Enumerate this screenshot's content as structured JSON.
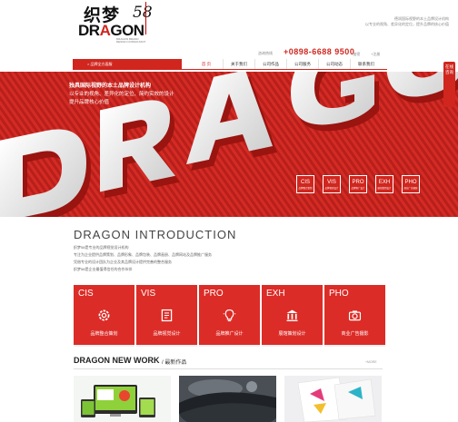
{
  "header": {
    "logo_cn": "织梦",
    "logo_num": "58",
    "logo_en_part1": "DR",
    "logo_en_accent": "A",
    "logo_en_part2": "GON",
    "logo_sub": "DRAGON BRAND DESIGN CONSULTANT",
    "intro_lines": [
      "德润国际视野的本土品牌设计机构",
      "以专业的视角、差异化的定位，提升品牌的核心价值"
    ],
    "phone_label": "咨询热线",
    "phone": "+0898-6688 9500",
    "link_login": "+加密",
    "link_reg": "+注册"
  },
  "nav": {
    "left_label": "> 品牌全方面服",
    "items": [
      "首 页",
      "关于我们",
      "公司作品",
      "公司服务",
      "公司动态",
      "联系我们"
    ],
    "active_index": 0
  },
  "side_tab": "在线咨询",
  "banner": {
    "title": "独具国际视野的本土品牌设计机构",
    "lines": [
      "以专业的视角、差异化的定位、简约实效的设计",
      "提升品牌核心价值"
    ],
    "services": [
      {
        "code": "CIS",
        "label": "品牌整合策划"
      },
      {
        "code": "VIS",
        "label": "品牌视觉设计"
      },
      {
        "code": "PRO",
        "label": "品牌推广设计"
      },
      {
        "code": "EXH",
        "label": "展馆策划设计"
      },
      {
        "code": "PHO",
        "label": "商业广告摄影"
      }
    ]
  },
  "intro": {
    "title": "DRAGON INTRODUCTION",
    "lines": [
      "织梦58是专业的品牌视觉设计机构",
      "专注为企业提供品牌策划、品牌形象、品牌包装、品牌画册、品牌网站及品牌推广服务",
      "凭借专业的设计团队为企业及其品牌设计提供完善的整合服务",
      "织梦58是企业最值得信任的合作伙伴"
    ]
  },
  "cards": [
    {
      "code": "CIS",
      "label": "品牌整合策划",
      "icon": "gear-icon"
    },
    {
      "code": "VIS",
      "label": "品牌视觉设计",
      "icon": "book-icon"
    },
    {
      "code": "PRO",
      "label": "品牌推广设计",
      "icon": "lightbulb-icon"
    },
    {
      "code": "EXH",
      "label": "展馆策划设计",
      "icon": "building-icon"
    },
    {
      "code": "PHO",
      "label": "商业广告摄影",
      "icon": "camera-icon"
    }
  ],
  "new_work": {
    "title": "DRAGON NEW WORK",
    "subtitle": "/ 最新作品",
    "more": "+MORE"
  },
  "colors": {
    "accent": "#d0261e"
  }
}
